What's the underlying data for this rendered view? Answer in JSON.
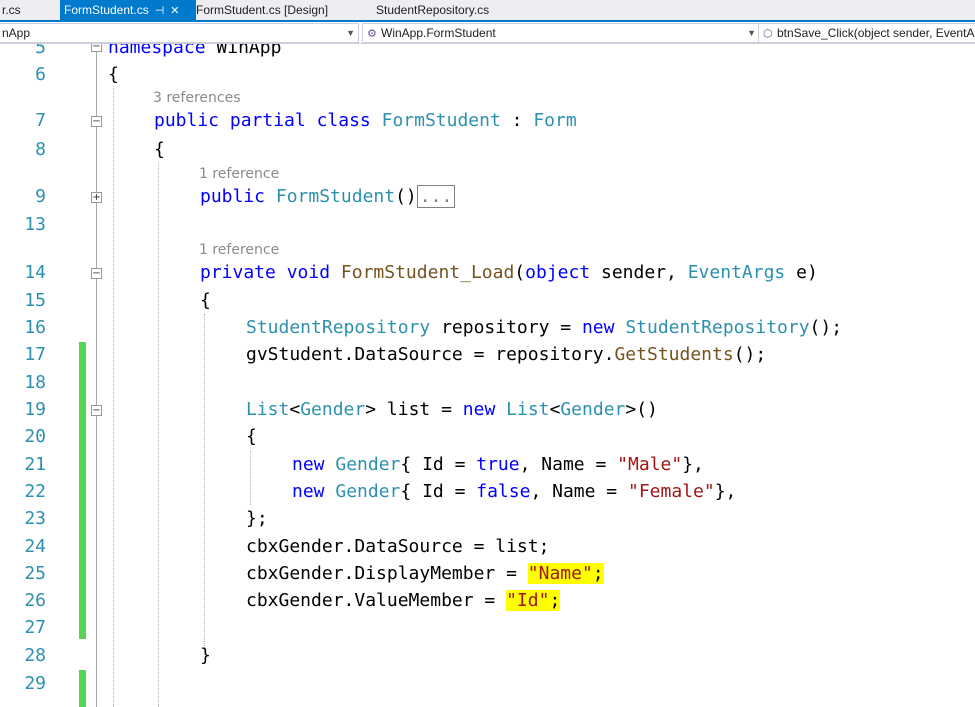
{
  "tabs": [
    {
      "label": "r.cs",
      "active": false
    },
    {
      "label": "FormStudent.cs",
      "active": true,
      "pin_icon": "pin-icon",
      "close_icon": "close-icon"
    },
    {
      "label": "FormStudent.cs [Design]",
      "active": false
    },
    {
      "label": "StudentRepository.cs",
      "active": false
    }
  ],
  "navbar": {
    "project": "nApp",
    "class": "WinApp.FormStudent",
    "member": "btnSave_Click(object sender, EventAr"
  },
  "editor": {
    "line_numbers": [
      "5",
      "6",
      "",
      "7",
      "8",
      "",
      "9",
      "13",
      "",
      "14",
      "15",
      "16",
      "17",
      "18",
      "19",
      "20",
      "21",
      "22",
      "23",
      "24",
      "25",
      "26",
      "27",
      "28",
      "29"
    ],
    "codelens": {
      "class_refs": "3 references",
      "ctor_refs": "1 reference",
      "load_refs": "1 reference"
    },
    "tokens": {
      "namespace": "namespace",
      "winapp": "WinApp",
      "lbrace": "{",
      "rbrace": "}",
      "public": "public",
      "partial": "partial",
      "class": "class",
      "formstudent": "FormStudent",
      "colon": " : ",
      "form": "Form",
      "parens": "()",
      "ellipsis": "...",
      "private": "private",
      "void": "void",
      "load_name": "FormStudent_Load",
      "lparen": "(",
      "object": "object",
      "sender": " sender, ",
      "eventargs": "EventArgs",
      "e": " e)",
      "studentrepo": "StudentRepository",
      "repo_var": " repository = ",
      "new": "new",
      "space": " ",
      "call_end": "();",
      "gv_ds": "gvStudent.DataSource = repository.",
      "getstudents": "GetStudents",
      "list": "List",
      "lt": "<",
      "gender": "Gender",
      "gt": ">",
      "list_var": " list = ",
      "gender_open": "{ Id = ",
      "true": "true",
      "false": "false",
      "name_eq": ", Name = ",
      "male": "\"Male\"",
      "female": "\"Female\"",
      "close_comma": "},",
      "semi_close": "};",
      "cbx_ds": "cbxGender.DataSource = list;",
      "cbx_dm": "cbxGender.DisplayMember = ",
      "name_str": "\"Name\"",
      "semi": ";",
      "cbx_vm": "cbxGender.ValueMember = ",
      "id_str": "\"Id\""
    }
  }
}
